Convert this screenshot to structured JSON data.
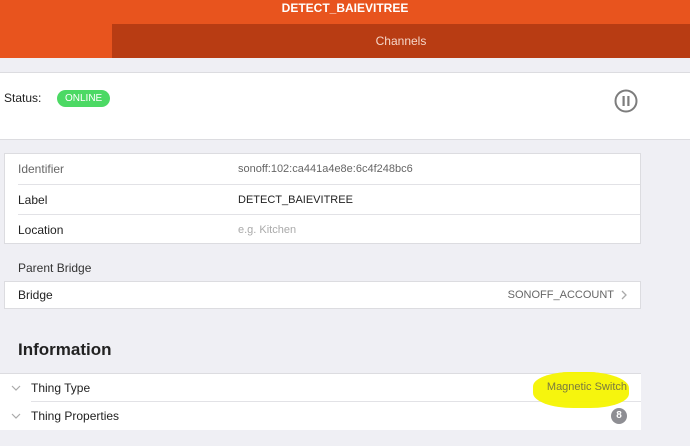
{
  "header": {
    "title": "DETECT_BAIEVITREE",
    "tab_label": "Channels"
  },
  "status": {
    "label": "Status:",
    "badge": "ONLINE"
  },
  "details": {
    "identifier_label": "Identifier",
    "identifier_value": "sonoff:102:ca441a4e8e:6c4f248bc6",
    "label_label": "Label",
    "label_value": "DETECT_BAIEVITREE",
    "location_label": "Location",
    "location_placeholder": "e.g. Kitchen"
  },
  "parent_bridge": {
    "header": "Parent Bridge",
    "bridge_label": "Bridge",
    "bridge_value": "SONOFF_ACCOUNT"
  },
  "information": {
    "heading": "Information",
    "thing_type_label": "Thing Type",
    "thing_type_value": "Magnetic Switch",
    "thing_properties_label": "Thing Properties",
    "thing_properties_count": "8"
  },
  "colors": {
    "header_bg": "#e8541e",
    "tab_bg": "#b83c13",
    "online_badge": "#4cd964",
    "highlight": "#f5f400"
  }
}
